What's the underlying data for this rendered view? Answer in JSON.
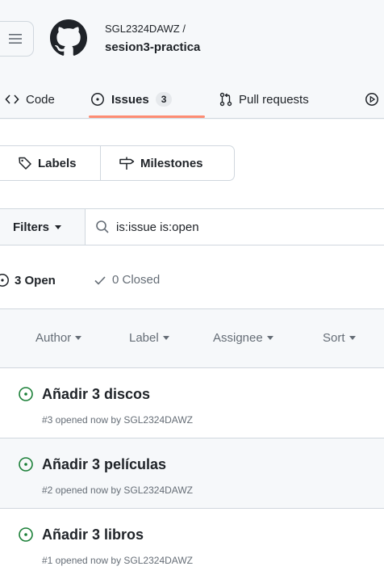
{
  "repo": {
    "owner": "SGL2324DAWZ /",
    "name": "sesion3-practica"
  },
  "tabs": [
    {
      "label": "Code"
    },
    {
      "label": "Issues",
      "count": "3"
    },
    {
      "label": "Pull requests"
    }
  ],
  "buttons": {
    "labels": "Labels",
    "milestones": "Milestones",
    "filters": "Filters"
  },
  "search": {
    "value": "is:issue is:open"
  },
  "states": {
    "open": "3 Open",
    "closed": "0 Closed"
  },
  "list_header": {
    "author": "Author",
    "label": "Label",
    "assignee": "Assignee",
    "sort": "Sort"
  },
  "issues": [
    {
      "title": "Añadir 3 discos",
      "meta": "#3 opened now by SGL2324DAWZ"
    },
    {
      "title": "Añadir 3 películas",
      "meta": "#2 opened now by SGL2324DAWZ"
    },
    {
      "title": "Añadir 3 libros",
      "meta": "#1 opened now by SGL2324DAWZ"
    }
  ],
  "colors": {
    "accent_underline": "#fd8c73",
    "open_icon": "#1a7f37",
    "muted_text": "#656d76",
    "border": "#d0d7de"
  },
  "icons": [
    "hamburger-icon",
    "github-logo-icon",
    "code-icon",
    "issue-opened-icon",
    "pull-request-icon",
    "play-icon",
    "tag-icon",
    "milestone-icon",
    "search-icon",
    "check-icon",
    "caret-down-icon"
  ]
}
